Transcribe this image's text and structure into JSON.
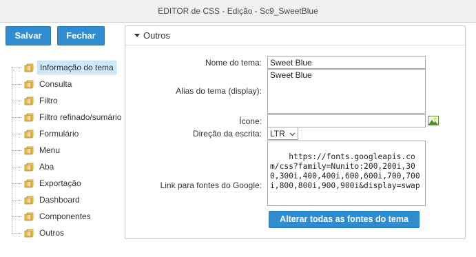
{
  "window": {
    "title": "EDITOR de CSS - Edição - Sc9_SweetBlue"
  },
  "toolbar": {
    "save_label": "Salvar",
    "close_label": "Fechar"
  },
  "tree": {
    "items": [
      {
        "label": "Informação do tema",
        "selected": true
      },
      {
        "label": "Consulta"
      },
      {
        "label": "Filtro"
      },
      {
        "label": "Filtro refinado/sumário"
      },
      {
        "label": "Formulário"
      },
      {
        "label": "Menu"
      },
      {
        "label": "Aba"
      },
      {
        "label": "Exportação"
      },
      {
        "label": "Dashboard"
      },
      {
        "label": "Componentes"
      },
      {
        "label": "Outros"
      }
    ]
  },
  "panel": {
    "title": "Outros",
    "fields": {
      "theme_name": {
        "label": "Nome do tema:",
        "value": "Sweet Blue"
      },
      "theme_alias": {
        "label": "Alias do tema (display):",
        "value": "Sweet Blue"
      },
      "icon": {
        "label": "Ícone:",
        "value": ""
      },
      "direction": {
        "label": "Direção da escrita:",
        "value": "LTR"
      },
      "fonts_link": {
        "label": "Link para fontes do Google:",
        "value": "https://fonts.googleapis.com/css?family=Nunito:200,200i,300,300i,400,400i,600,600i,700,700i,800,800i,900,900i&display=swap"
      }
    },
    "alter_fonts_button": "Alterar todas as fontes do tema"
  },
  "colors": {
    "accent": "#2f8ccf",
    "selection": "#cfe8fb"
  }
}
